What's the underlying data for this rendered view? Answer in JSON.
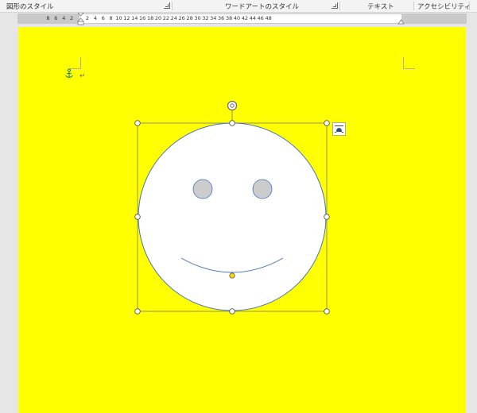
{
  "ribbon": {
    "groups": [
      {
        "label": "図形のスタイル"
      },
      {
        "label": "ワードアートのスタイル"
      },
      {
        "label": "テキスト"
      },
      {
        "label": "アクセシビリティ"
      }
    ]
  },
  "ruler": {
    "left_labels": [
      "8",
      "6",
      "4",
      "2"
    ],
    "right_labels": [
      "2",
      "4",
      "6",
      "8",
      "10",
      "12",
      "14",
      "16",
      "18",
      "20",
      "22",
      "24",
      "26",
      "28",
      "30",
      "32",
      "34",
      "36",
      "38",
      "40",
      "42",
      "44",
      "46",
      "48"
    ]
  },
  "document": {
    "page_color": "#ffff00",
    "paragraph_mark": "↵",
    "shape": {
      "type": "smiley-face",
      "fill_color": "#ffffff",
      "outline_color": "#4472c4",
      "eye_fill_color": "#cccccc",
      "handle_color": "#ffd400",
      "selected": true
    }
  }
}
